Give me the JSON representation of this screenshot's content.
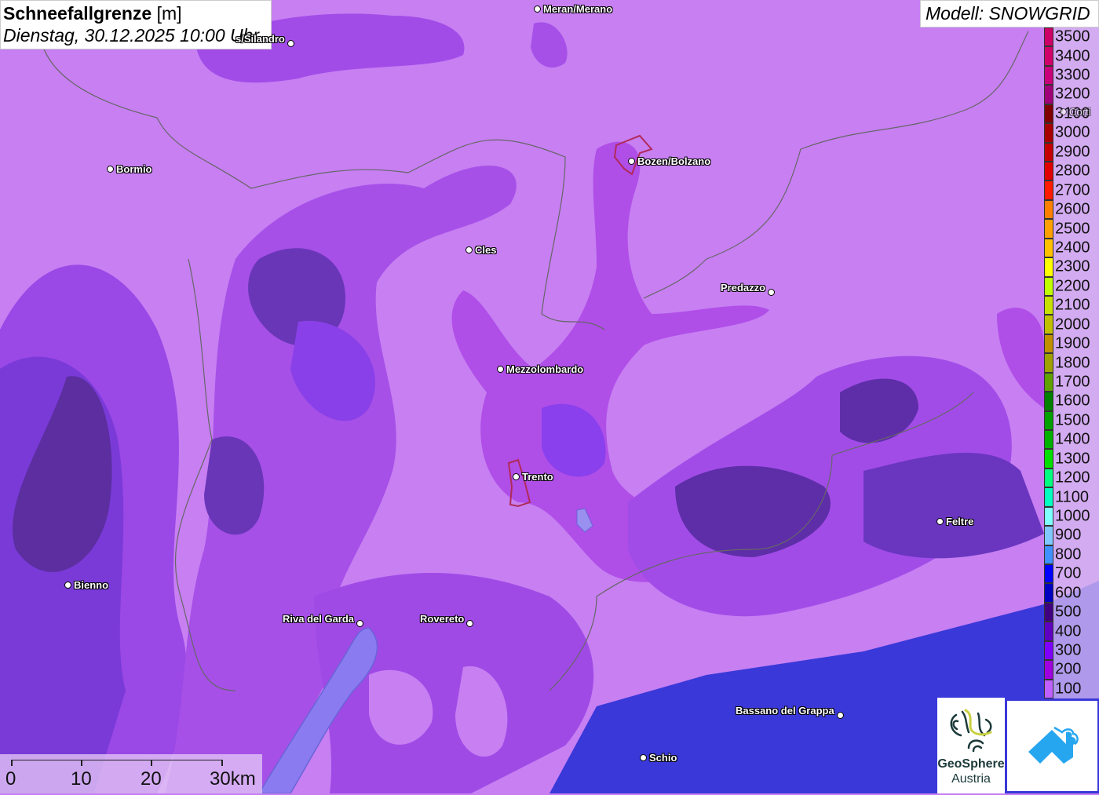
{
  "header": {
    "title": "Schneefallgrenze",
    "unit": "[m]",
    "datetime": "Dienstag, 30.12.2025 10:00 Uhr",
    "model": "Modell: SNOWGRID"
  },
  "legend": [
    {
      "label": "3500",
      "color": "#cc0066"
    },
    {
      "label": "3400",
      "color": "#d0006a"
    },
    {
      "label": "3300",
      "color": "#c8007a"
    },
    {
      "label": "3200",
      "color": "#a00078"
    },
    {
      "label": "3100",
      "color": "#800000"
    },
    {
      "label": "3000",
      "color": "#a80000"
    },
    {
      "label": "2900",
      "color": "#c40000"
    },
    {
      "label": "2800",
      "color": "#e00000"
    },
    {
      "label": "2700",
      "color": "#ff1a00"
    },
    {
      "label": "2600",
      "color": "#ff8000"
    },
    {
      "label": "2500",
      "color": "#ffa000"
    },
    {
      "label": "2400",
      "color": "#ffc000"
    },
    {
      "label": "2300",
      "color": "#ffff00"
    },
    {
      "label": "2200",
      "color": "#c0ff00"
    },
    {
      "label": "2100",
      "color": "#c8e000"
    },
    {
      "label": "2000",
      "color": "#c0c000"
    },
    {
      "label": "1900",
      "color": "#c09000"
    },
    {
      "label": "1800",
      "color": "#a0a000"
    },
    {
      "label": "1700",
      "color": "#60a000"
    },
    {
      "label": "1600",
      "color": "#008000"
    },
    {
      "label": "1500",
      "color": "#00a000"
    },
    {
      "label": "1400",
      "color": "#00b000"
    },
    {
      "label": "1300",
      "color": "#00e000"
    },
    {
      "label": "1200",
      "color": "#00ff80"
    },
    {
      "label": "1100",
      "color": "#00ffc0"
    },
    {
      "label": "1000",
      "color": "#80ffff"
    },
    {
      "label": "900",
      "color": "#80c8ff"
    },
    {
      "label": "800",
      "color": "#4090ff"
    },
    {
      "label": "700",
      "color": "#0000ff"
    },
    {
      "label": "600",
      "color": "#0000c0"
    },
    {
      "label": "500",
      "color": "#400080"
    },
    {
      "label": "400",
      "color": "#6000c0"
    },
    {
      "label": "300",
      "color": "#8000ff"
    },
    {
      "label": "200",
      "color": "#a000e0"
    },
    {
      "label": "100",
      "color": "#c060ff"
    }
  ],
  "cities": [
    {
      "name": "Meran/Merano"
    },
    {
      "name": "s/Silandro"
    },
    {
      "name": "Bormio"
    },
    {
      "name": "Bozen/Bolzano"
    },
    {
      "name": "Cles"
    },
    {
      "name": "Predazzo"
    },
    {
      "name": "Mezzolombardo"
    },
    {
      "name": "Trento"
    },
    {
      "name": "Feltre"
    },
    {
      "name": "Bienno"
    },
    {
      "name": "Riva del Garda"
    },
    {
      "name": "Rovereto"
    },
    {
      "name": "Bassano del Grappa"
    },
    {
      "name": "Schio"
    },
    {
      "name": "Corti"
    }
  ],
  "scale": {
    "labels": [
      "0",
      "10",
      "20",
      "30km"
    ]
  },
  "logos": {
    "geosphere_line1": "GeoSphere",
    "geosphere_line2": "Austria"
  }
}
